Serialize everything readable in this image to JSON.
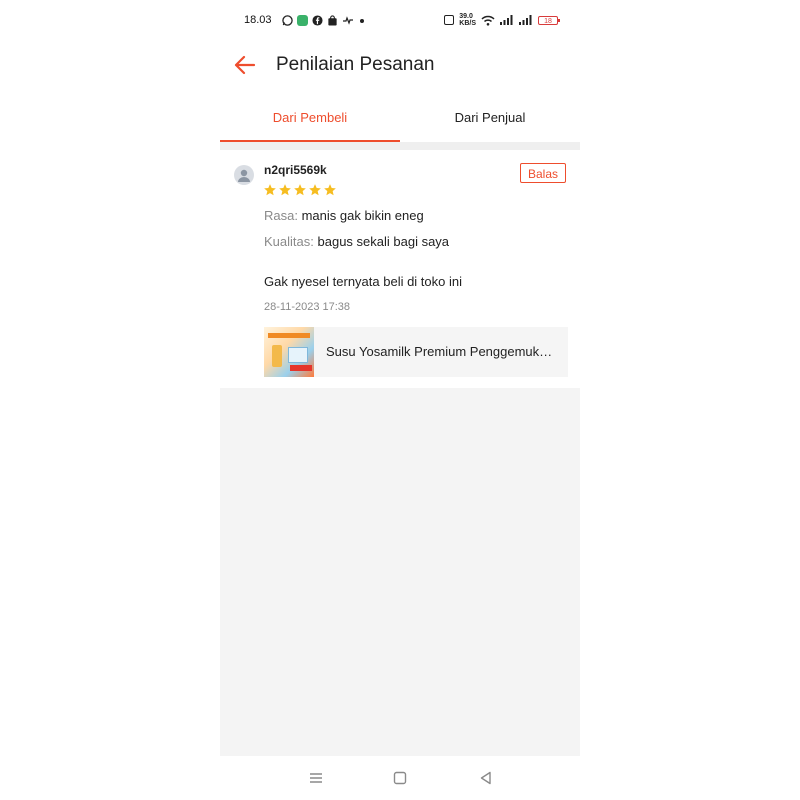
{
  "status_bar": {
    "time": "18.03",
    "net_speed_top": "39.0",
    "net_speed_bottom": "KB/S",
    "battery": "18",
    "icons": [
      "whatsapp-icon",
      "app-icon",
      "facebook-icon",
      "shopping-bag-icon",
      "mail-icon",
      "dot-icon",
      "nfc-icon",
      "wifi-icon",
      "signal-icon",
      "battery-icon"
    ]
  },
  "header": {
    "title": "Penilaian Pesanan",
    "back_icon": "arrow-left-icon"
  },
  "tabs": [
    {
      "label": "Dari Pembeli",
      "active": true
    },
    {
      "label": "Dari Penjual",
      "active": false
    }
  ],
  "review": {
    "username": "n2qri5569k",
    "reply_label": "Balas",
    "rating": 5,
    "attributes": [
      {
        "key": "Rasa:",
        "value": "manis gak bikin eneg"
      },
      {
        "key": "Kualitas:",
        "value": "bagus sekali bagi saya"
      }
    ],
    "comment": "Gak nyesel ternyata beli di toko ini",
    "date": "28-11-2023 17:38",
    "product_name": "Susu Yosamilk Premium Penggemuk Badan"
  },
  "colors": {
    "accent": "#ee4d2d",
    "star": "#f6bd21",
    "muted": "#8a8a8a",
    "background": "#f4f4f4"
  },
  "navbar": {
    "icons": [
      "menu-icon",
      "home-square-icon",
      "back-triangle-icon"
    ]
  }
}
